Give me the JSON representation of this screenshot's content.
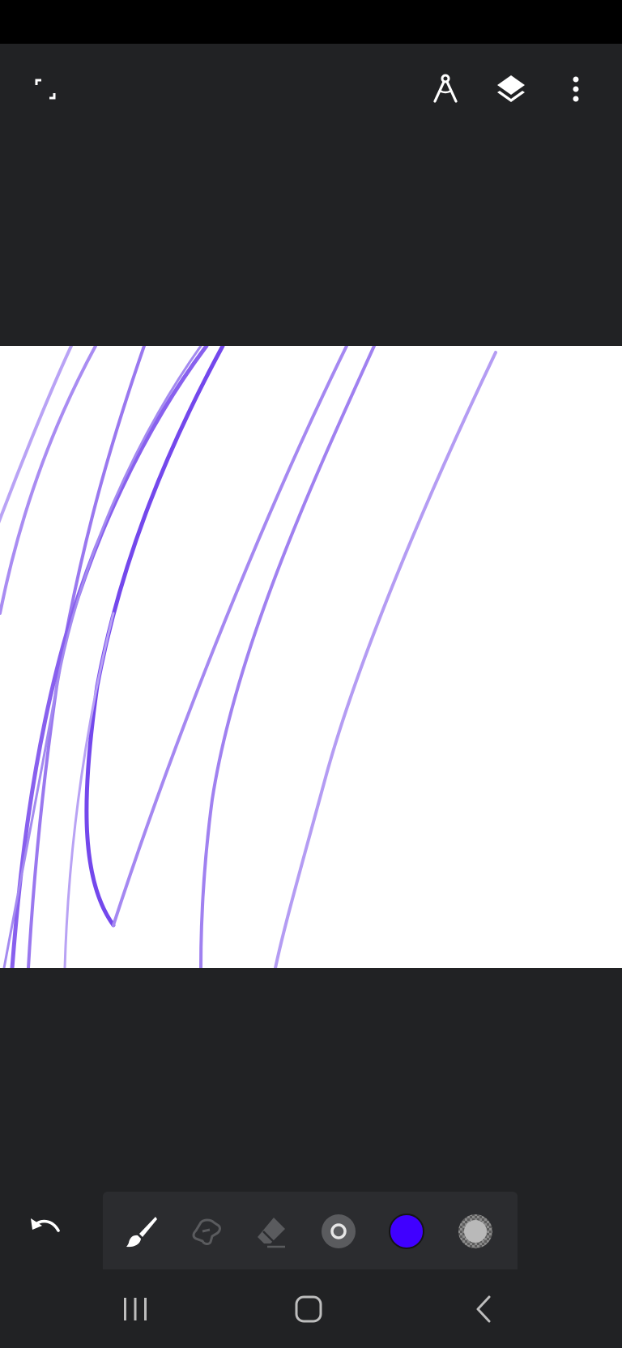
{
  "app": {
    "name": "",
    "theme": {
      "background": "#212224",
      "canvas": "#ffffff",
      "stroke_color": "#7a4ff0",
      "accent": "#4000ff"
    }
  },
  "top_bar": {
    "left_icons": [
      "fullscreen-icon"
    ],
    "right_icons": [
      "compass-icon",
      "layers-icon",
      "more-vert-icon"
    ]
  },
  "toolbar": {
    "undo_icon": "undo-icon",
    "tools": [
      {
        "name": "brush",
        "icon": "brush-icon",
        "selected": true
      },
      {
        "name": "smudge",
        "icon": "smudge-icon",
        "selected": false
      },
      {
        "name": "eraser",
        "icon": "eraser-icon",
        "selected": false
      },
      {
        "name": "brush-size",
        "icon": "brush-size-icon",
        "selected": false
      },
      {
        "name": "color",
        "icon": "color-swatch-icon",
        "color": "#4000ff"
      },
      {
        "name": "opacity",
        "icon": "opacity-icon",
        "selected": false
      }
    ]
  },
  "system_nav": {
    "buttons": [
      "recent-apps-icon",
      "home-icon",
      "back-icon"
    ]
  }
}
